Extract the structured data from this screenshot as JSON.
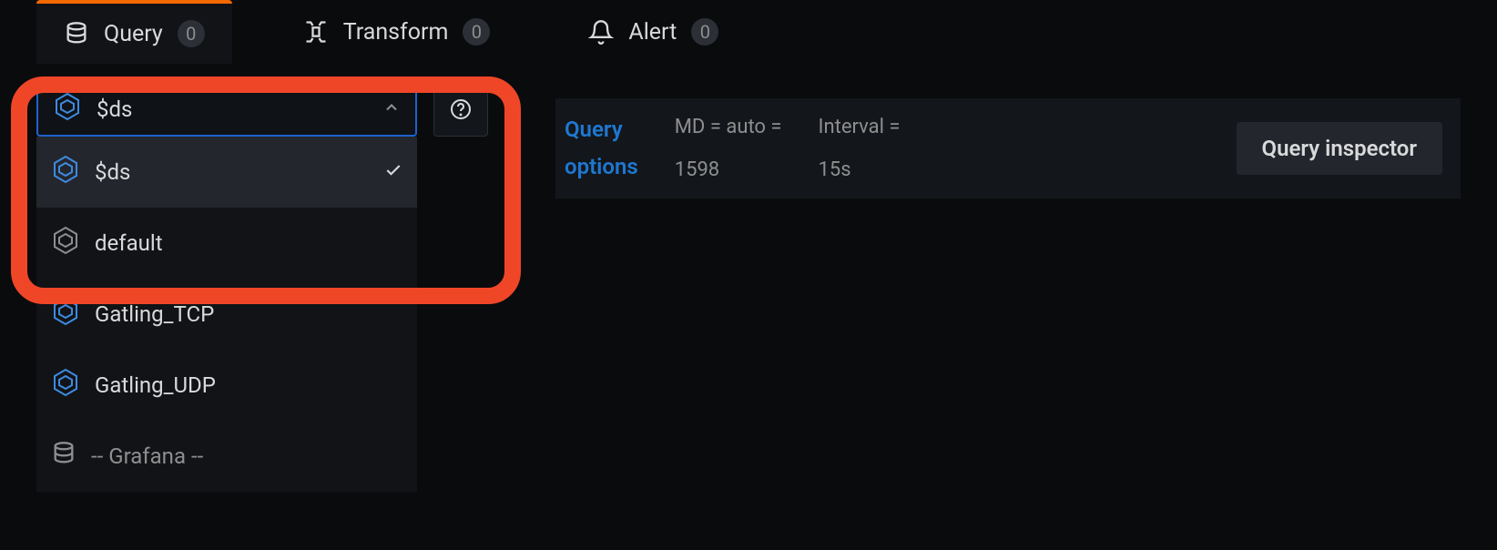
{
  "tabs": {
    "query": {
      "label": "Query",
      "count": "0"
    },
    "transform": {
      "label": "Transform",
      "count": "0"
    },
    "alert": {
      "label": "Alert",
      "count": "0"
    }
  },
  "datasource": {
    "selected": "$ds",
    "options": [
      {
        "label": "$ds",
        "selected": true,
        "type": "poly"
      },
      {
        "label": "default",
        "selected": false,
        "type": "poly"
      },
      {
        "label": "Gatling_TCP",
        "selected": false,
        "type": "poly"
      },
      {
        "label": "Gatling_UDP",
        "selected": false,
        "type": "poly"
      },
      {
        "label": "-- Grafana --",
        "selected": false,
        "type": "db"
      }
    ]
  },
  "query_options": {
    "label": "Query options",
    "md_label": "MD = auto =",
    "md_value": "1598",
    "interval_label": "Interval =",
    "interval_value": "15s",
    "inspector_button": "Query inspector"
  }
}
